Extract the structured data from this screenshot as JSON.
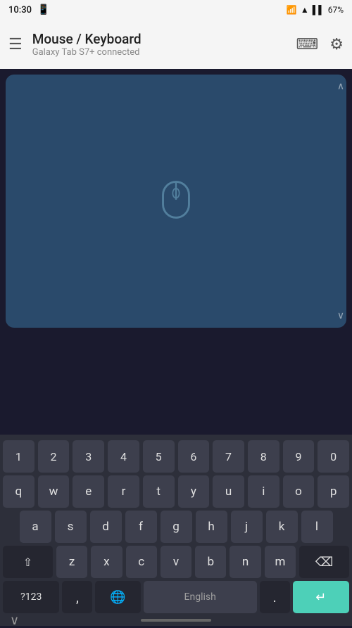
{
  "statusBar": {
    "time": "10:30",
    "batteryPercent": "67%"
  },
  "appBar": {
    "title": "Mouse / Keyboard",
    "subtitle": "Galaxy Tab S7+ connected"
  },
  "keyboard": {
    "row0": [
      "1",
      "2",
      "3",
      "4",
      "5",
      "6",
      "7",
      "8",
      "9",
      "0"
    ],
    "row1": [
      "q",
      "w",
      "e",
      "r",
      "t",
      "y",
      "u",
      "i",
      "o",
      "p"
    ],
    "row2": [
      "a",
      "s",
      "d",
      "f",
      "g",
      "h",
      "j",
      "k",
      "l"
    ],
    "row3": [
      "z",
      "x",
      "c",
      "v",
      "b",
      "n",
      "m"
    ],
    "bottomRow": {
      "sym": "?123",
      "comma": ",",
      "globe": "⊕",
      "space": "English",
      "dot": ".",
      "enter": "↵"
    }
  },
  "icons": {
    "menu": "☰",
    "keyboard": "⌨",
    "settings": "⚙",
    "bluetooth": "⚡",
    "wifi": "▲",
    "signal": "▌",
    "shift": "⇧",
    "delete": "⌫",
    "chevronDown": "∨",
    "scrollUp": "∧",
    "scrollDown": "∨"
  },
  "colors": {
    "accent": "#4dd0b8",
    "trackpadBg": "#2a4a6b",
    "keyboardBg": "#2d2f3a"
  }
}
